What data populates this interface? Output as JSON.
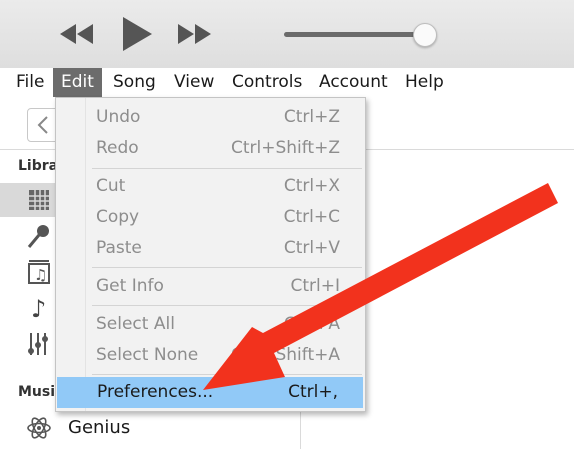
{
  "player": {
    "rewind_icon": "rewind-icon",
    "play_icon": "play-icon",
    "fast_forward_icon": "fast-forward-icon",
    "volume_level": 0.93
  },
  "menubar": {
    "items": [
      "File",
      "Edit",
      "Song",
      "View",
      "Controls",
      "Account",
      "Help"
    ],
    "active": "Edit"
  },
  "sidebar": {
    "library_heading": "Libra",
    "music_heading": "Musi",
    "genius_label": "Genius"
  },
  "edit_menu": {
    "items": [
      {
        "label": "Undo",
        "shortcut": "Ctrl+Z",
        "enabled": false
      },
      {
        "label": "Redo",
        "shortcut": "Ctrl+Shift+Z",
        "enabled": false
      },
      {
        "label": "Cut",
        "shortcut": "Ctrl+X",
        "enabled": false
      },
      {
        "label": "Copy",
        "shortcut": "Ctrl+C",
        "enabled": false
      },
      {
        "label": "Paste",
        "shortcut": "Ctrl+V",
        "enabled": false
      },
      {
        "label": "Get Info",
        "shortcut": "Ctrl+I",
        "enabled": false
      },
      {
        "label": "Select All",
        "shortcut": "Ctrl+A",
        "enabled": false
      },
      {
        "label": "Select None",
        "shortcut": "Ctrl+Shift+A",
        "enabled": false
      },
      {
        "label": "Preferences...",
        "shortcut": "Ctrl+,",
        "enabled": true,
        "highlighted": true
      }
    ]
  },
  "colors": {
    "highlight": "#91c9f7",
    "annotation_arrow": "#f2321d",
    "active_menu": "#6c6c6c"
  }
}
